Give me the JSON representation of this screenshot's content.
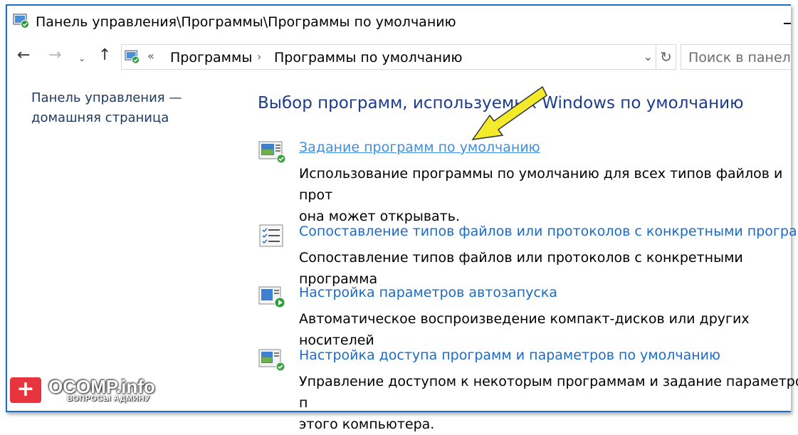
{
  "window": {
    "title": "Панель управления\\Программы\\Программы по умолчанию"
  },
  "nav": {
    "back_icon": "arrow-left-icon",
    "forward_icon": "arrow-right-icon",
    "recent_icon": "chevron-down-icon",
    "up_icon": "arrow-up-icon",
    "address": {
      "chevron": "«",
      "crumbs": [
        "Программы",
        "Программы по умолчанию"
      ]
    },
    "search_placeholder": "Поиск в панели"
  },
  "sidebar": {
    "home_link": {
      "line1": "Панель управления —",
      "line2": "домашняя страница"
    }
  },
  "main": {
    "heading": "Выбор программ, используемых Windows по умолчанию",
    "items": [
      {
        "link": "Задание программ по умолчанию",
        "desc": "Использование программы по умолчанию для всех типов файлов и прот",
        "desc2": "она может открывать.",
        "icon": "default-programs-icon"
      },
      {
        "link": "Сопоставление типов файлов или протоколов с конкретными программа",
        "desc": "Сопоставление типов файлов или протоколов с конкретными программа",
        "icon": "file-associations-icon"
      },
      {
        "link": "Настройка параметров автозапуска",
        "desc": "Автоматическое воспроизведение компакт-дисков или других носителей",
        "icon": "autoplay-icon"
      },
      {
        "link": "Настройка доступа программ и параметров по умолчанию",
        "desc": "Управление доступом к некоторым программам и задание параметров п",
        "desc2": "этого компьютера.",
        "icon": "program-access-icon"
      }
    ]
  },
  "watermark": {
    "badge": "+",
    "title": "OCOMP.info",
    "subtitle": "ВОПРОСЫ АДМИНУ"
  },
  "colors": {
    "link": "#1a6bc7",
    "heading": "#1c3c8c",
    "frame": "#1c6fc1",
    "arrow": "#f2ea2a"
  }
}
